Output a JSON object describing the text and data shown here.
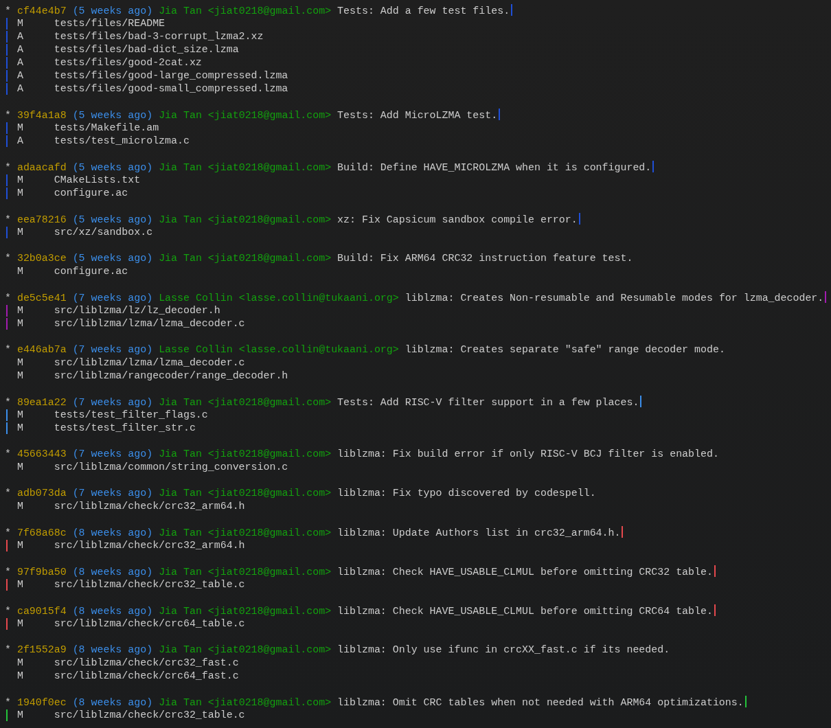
{
  "commits": [
    {
      "graph": "*",
      "hash": "cf44e4b7",
      "date": "(5 weeks ago)",
      "author": "Jia Tan <jiat0218@gmail.com>",
      "message": "Tests: Add a few test files.",
      "color": "#1f4fd6",
      "files": [
        {
          "status": "M",
          "path": "tests/files/README"
        },
        {
          "status": "A",
          "path": "tests/files/bad-3-corrupt_lzma2.xz"
        },
        {
          "status": "A",
          "path": "tests/files/bad-dict_size.lzma"
        },
        {
          "status": "A",
          "path": "tests/files/good-2cat.xz"
        },
        {
          "status": "A",
          "path": "tests/files/good-large_compressed.lzma"
        },
        {
          "status": "A",
          "path": "tests/files/good-small_compressed.lzma"
        }
      ]
    },
    {
      "graph": "*",
      "hash": "39f4a1a8",
      "date": "(5 weeks ago)",
      "author": "Jia Tan <jiat0218@gmail.com>",
      "message": "Tests: Add MicroLZMA test.",
      "color": "#1f4fd6",
      "files": [
        {
          "status": "M",
          "path": "tests/Makefile.am"
        },
        {
          "status": "A",
          "path": "tests/test_microlzma.c"
        }
      ]
    },
    {
      "graph": "*",
      "hash": "adaacafd",
      "date": "(5 weeks ago)",
      "author": "Jia Tan <jiat0218@gmail.com>",
      "message": "Build: Define HAVE_MICROLZMA when it is configured.",
      "color": "#1f4fd6",
      "files": [
        {
          "status": "M",
          "path": "CMakeLists.txt"
        },
        {
          "status": "M",
          "path": "configure.ac"
        }
      ]
    },
    {
      "graph": "*",
      "hash": "eea78216",
      "date": "(5 weeks ago)",
      "author": "Jia Tan <jiat0218@gmail.com>",
      "message": "xz: Fix Capsicum sandbox compile error.",
      "color": "#1f4fd6",
      "files": [
        {
          "status": "M",
          "path": "src/xz/sandbox.c"
        }
      ]
    },
    {
      "graph": "*",
      "hash": "32b0a3ce",
      "date": "(5 weeks ago)",
      "author": "Jia Tan <jiat0218@gmail.com>",
      "message": "Build: Fix ARM64 CRC32 instruction feature test.",
      "files": [
        {
          "status": "M",
          "path": "configure.ac"
        }
      ]
    },
    {
      "graph": "*",
      "hash": "de5c5e41",
      "date": "(7 weeks ago)",
      "author": "Lasse Collin <lasse.collin@tukaani.org>",
      "message": "liblzma: Creates Non-resumable and Resumable modes for lzma_decoder.",
      "color": "#a21caf",
      "files": [
        {
          "status": "M",
          "path": "src/liblzma/lz/lz_decoder.h"
        },
        {
          "status": "M",
          "path": "src/liblzma/lzma/lzma_decoder.c"
        }
      ]
    },
    {
      "graph": "*",
      "hash": "e446ab7a",
      "date": "(7 weeks ago)",
      "author": "Lasse Collin <lasse.collin@tukaani.org>",
      "message": "liblzma: Creates separate \"safe\" range decoder mode.",
      "files": [
        {
          "status": "M",
          "path": "src/liblzma/lzma/lzma_decoder.c"
        },
        {
          "status": "M",
          "path": "src/liblzma/rangecoder/range_decoder.h"
        }
      ]
    },
    {
      "graph": "*",
      "hash": "89ea1a22",
      "date": "(7 weeks ago)",
      "author": "Jia Tan <jiat0218@gmail.com>",
      "message": "Tests: Add RISC-V filter support in a few places.",
      "color": "#3b8eea",
      "files": [
        {
          "status": "M",
          "path": "tests/test_filter_flags.c"
        },
        {
          "status": "M",
          "path": "tests/test_filter_str.c"
        }
      ]
    },
    {
      "graph": "*",
      "hash": "45663443",
      "date": "(7 weeks ago)",
      "author": "Jia Tan <jiat0218@gmail.com>",
      "message": "liblzma: Fix build error if only RISC-V BCJ filter is enabled.",
      "files": [
        {
          "status": "M",
          "path": "src/liblzma/common/string_conversion.c"
        }
      ]
    },
    {
      "graph": "*",
      "hash": "adb073da",
      "date": "(7 weeks ago)",
      "author": "Jia Tan <jiat0218@gmail.com>",
      "message": "liblzma: Fix typo discovered by codespell.",
      "files": [
        {
          "status": "M",
          "path": "src/liblzma/check/crc32_arm64.h"
        }
      ]
    },
    {
      "graph": "*",
      "hash": "7f68a68c",
      "date": "(8 weeks ago)",
      "author": "Jia Tan <jiat0218@gmail.com>",
      "message": "liblzma: Update Authors list in crc32_arm64.h.",
      "color": "#e5484d",
      "files": [
        {
          "status": "M",
          "path": "src/liblzma/check/crc32_arm64.h"
        }
      ]
    },
    {
      "graph": "*",
      "hash": "97f9ba50",
      "date": "(8 weeks ago)",
      "author": "Jia Tan <jiat0218@gmail.com>",
      "message": "liblzma: Check HAVE_USABLE_CLMUL before omitting CRC32 table.",
      "color": "#e5484d",
      "files": [
        {
          "status": "M",
          "path": "src/liblzma/check/crc32_table.c"
        }
      ]
    },
    {
      "graph": "*",
      "hash": "ca9015f4",
      "date": "(8 weeks ago)",
      "author": "Jia Tan <jiat0218@gmail.com>",
      "message": "liblzma: Check HAVE_USABLE_CLMUL before omitting CRC64 table.",
      "color": "#e5484d",
      "files": [
        {
          "status": "M",
          "path": "src/liblzma/check/crc64_table.c"
        }
      ]
    },
    {
      "graph": "*",
      "hash": "2f1552a9",
      "date": "(8 weeks ago)",
      "author": "Jia Tan <jiat0218@gmail.com>",
      "message": "liblzma: Only use ifunc in crcXX_fast.c if its needed.",
      "files": [
        {
          "status": "M",
          "path": "src/liblzma/check/crc32_fast.c"
        },
        {
          "status": "M",
          "path": "src/liblzma/check/crc64_fast.c"
        }
      ]
    },
    {
      "graph": "*",
      "hash": "1940f0ec",
      "date": "(8 weeks ago)",
      "author": "Jia Tan <jiat0218@gmail.com>",
      "message": "liblzma: Omit CRC tables when not needed with ARM64 optimizations.",
      "color": "#23c43a",
      "files": [
        {
          "status": "M",
          "path": "src/liblzma/check/crc32_table.c"
        }
      ]
    }
  ]
}
